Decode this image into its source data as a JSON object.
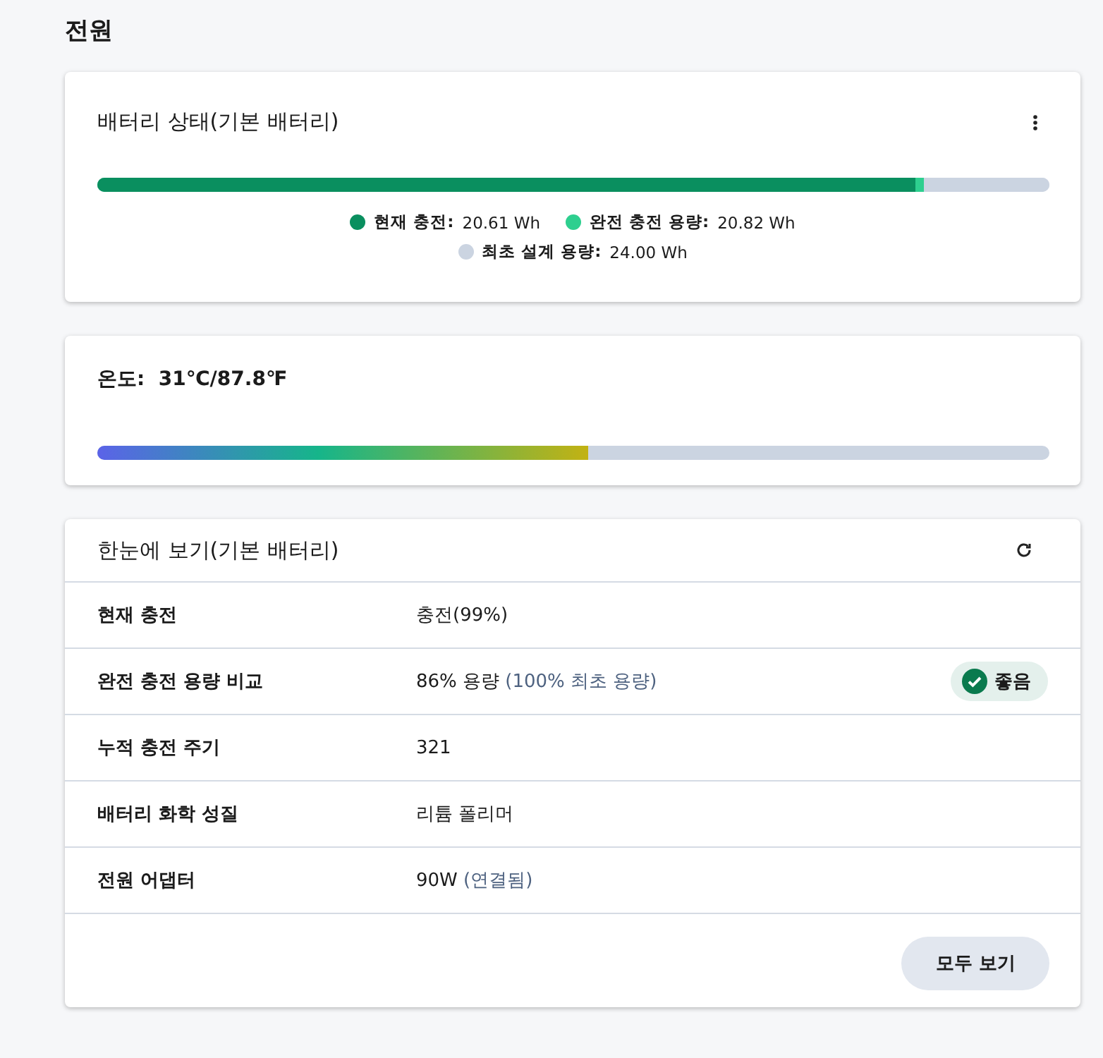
{
  "page_title": "전원",
  "battery_status": {
    "title": "배터리 상태(기본 배터리)",
    "segments": [
      {
        "label": "현재 충전:",
        "reading": "20.61 Wh",
        "level": 0.859,
        "color": "#0a8f5f"
      },
      {
        "label": "완전 충전 용량:",
        "reading": "20.82 Wh",
        "level": 0.868,
        "color": "#2ecf8f"
      },
      {
        "label": "최초 설계 용량:",
        "reading": "24.00 Wh",
        "level": 1,
        "color": "#cbd4e1"
      }
    ]
  },
  "temperature": {
    "label": "온도:",
    "reading": "31℃/87.8℉",
    "level": 0.515
  },
  "overview": {
    "title": "한눈에 보기(기본 배터리)",
    "rows": [
      {
        "label": "현재 충전",
        "value": "충전(99%)"
      },
      {
        "label": "완전 충전 용량 비교",
        "value": "86% 용량",
        "note": "(100% 최초 용량)",
        "badge": {
          "label": "좋음",
          "color": "#0a7a4e"
        }
      },
      {
        "label": "누적 충전 주기",
        "value": "321"
      },
      {
        "label": "배터리 화학 성질",
        "value": "리튬 폴리머"
      },
      {
        "label": "전원 어댑터",
        "value": "90W",
        "note": "(연결됨)"
      }
    ],
    "button": "모두 보기"
  }
}
